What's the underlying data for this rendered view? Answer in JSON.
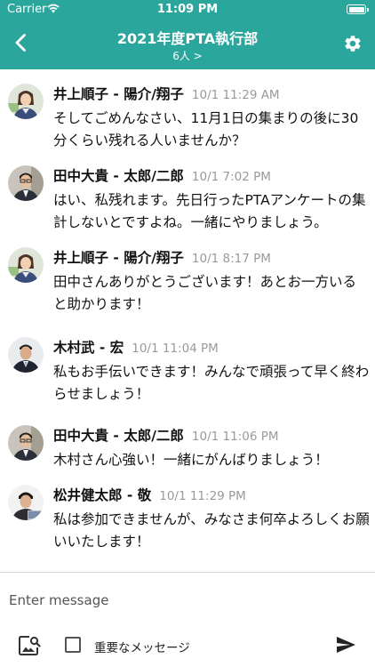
{
  "status_bar": {
    "carrier": "Carrier",
    "time": "11:09 PM"
  },
  "header": {
    "title": "2021年度PTA執行部",
    "member_count": "6人 >",
    "colors": {
      "background": "#2aa69c",
      "text": "#ffffff"
    }
  },
  "messages": [
    {
      "author": "井上順子 - 陽介/翔子",
      "timestamp": "10/1 11:29 AM",
      "text": "そしてごめんなさい、11月1日の集まりの後に30分くらい残れる人いませんか？",
      "avatar": "avatar-woman"
    },
    {
      "author": "田中大貴 - 太郎/二郎",
      "timestamp": "10/1 7:02 PM",
      "text": "はい、私残れます。先日行ったPTAアンケートの集計しないとですよね。一緒にやりましょう。",
      "avatar": "avatar-man-glasses"
    },
    {
      "author": "井上順子 - 陽介/翔子",
      "timestamp": "10/1 8:17 PM",
      "text": "田中さんありがとうございます！あとお一方いると助かります！",
      "avatar": "avatar-woman"
    },
    {
      "author": "木村武 - 宏",
      "timestamp": "10/1 11:04 PM",
      "text": "私もお手伝いできます！みんなで頑張って早く終わらせましょう！",
      "avatar": "avatar-man-suit"
    },
    {
      "author": "田中大貴 - 太郎/二郎",
      "timestamp": "10/1 11:06 PM",
      "text": "木村さん心強い！一緒にがんばりましょう！",
      "avatar": "avatar-man-glasses"
    },
    {
      "author": "松井健太郎 - 敬",
      "timestamp": "10/1 11:29 PM",
      "text": "私は参加できませんが、みなさま何卒よろしくお願いいたします！",
      "avatar": "avatar-man-laptop"
    }
  ],
  "composer": {
    "placeholder": "Enter message",
    "important_label": "重要なメッセージ",
    "important_checked": false
  },
  "icons": {
    "back": "chevron-left-icon",
    "settings": "gear-icon",
    "attach": "image-search-icon",
    "send": "send-icon"
  }
}
